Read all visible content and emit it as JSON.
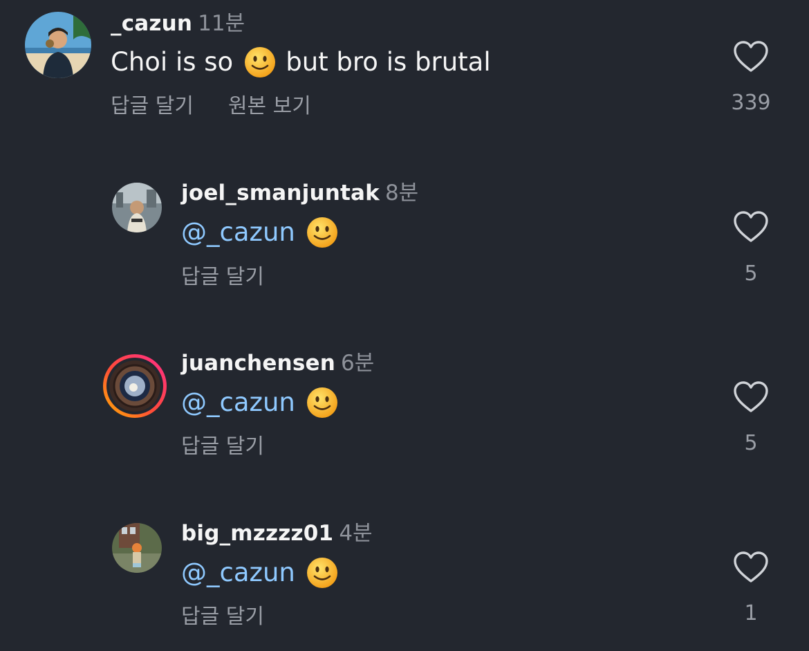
{
  "comments": [
    {
      "username": "_cazun",
      "time": "11분",
      "text_before": "Choi is so",
      "text_after": "but bro is brutal",
      "emoji": "slightly-smiling-face",
      "actions": [
        "답글 달기",
        "원본 보기"
      ],
      "likes": "339"
    },
    {
      "username": "joel_smanjuntak",
      "time": "8분",
      "mention": "@_cazun",
      "emoji": "slightly-smiling-face",
      "actions": [
        "답글 달기"
      ],
      "likes": "5"
    },
    {
      "username": "juanchensen",
      "time": "6분",
      "mention": "@_cazun",
      "emoji": "slightly-smiling-face",
      "actions": [
        "답글 달기"
      ],
      "likes": "5",
      "story_ring": true
    },
    {
      "username": "big_mzzzz01",
      "time": "4분",
      "mention": "@_cazun",
      "emoji": "slightly-smiling-face",
      "actions": [
        "답글 달기"
      ],
      "likes": "1"
    }
  ],
  "colors": {
    "background": "#23272f",
    "mention": "#8fc9ff",
    "secondary_text": "#9a9ea6",
    "story_ring_start": "#ff2d8a",
    "story_ring_end": "#ffb300"
  }
}
